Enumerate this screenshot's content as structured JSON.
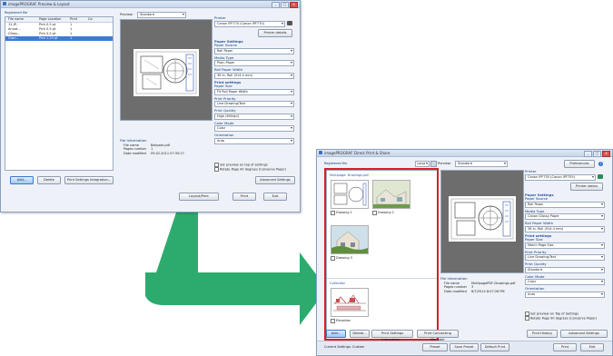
{
  "arrow_color": "#2dab6e",
  "highlight_color": "#d8202a",
  "window1": {
    "title": "imagePROGRAF Preview & Layout",
    "sort_label": "Registered file",
    "columns": [
      "File name",
      "Page Location",
      "Print",
      "Co"
    ],
    "files": [
      {
        "name": "12.JP...",
        "loc": "Pmt 0.5 pt",
        "print": "1"
      },
      {
        "name": "Annot...",
        "loc": "Pmt 0.5 pt",
        "print": "1"
      },
      {
        "name": "Gilroy...",
        "loc": "Pmt 0.5 pt",
        "print": "1"
      },
      {
        "name": "Gran...",
        "loc": "Pmt 1.25 pt",
        "print": "1"
      }
    ],
    "preview_label": "Preview:",
    "preview_value": "Standard",
    "printer_label": "Printer",
    "printer_value": "Canon iPF770 (Canon iPF770)",
    "printer_button": "Printer details",
    "sections": [
      {
        "title": "Paper Settings",
        "fields": [
          "Paper Source",
          "Roll Paper",
          "Media Type",
          "Plain Paper",
          "Roll Paper Width",
          "36 in. Roll (914.4 mm)"
        ]
      },
      {
        "title": "Print settings",
        "fields": [
          "Paper Size",
          "Fit Roll Paper Width",
          "Print Priority",
          "Line Drawing/Text",
          "Print Quality",
          "High (600dpi)",
          "Color Mode",
          "Color",
          "Orientation",
          "Auto"
        ]
      }
    ],
    "file_info_title": "File Information",
    "file_info": [
      {
        "k": "File name",
        "v": "Ballpark.pdf"
      },
      {
        "k": "Pages number",
        "v": "1"
      },
      {
        "k": "Date modified",
        "v": "09.02.2011 07:35:27"
      }
    ],
    "checks": [
      "Set preview on top of settings",
      "Rotate Page 90 degrees (Conserve Paper)"
    ],
    "buttons": {
      "add": "Add...",
      "delete": "Delete",
      "print_settings": "Print Settings Integration...",
      "advanced": "Advanced Settings",
      "layout": "Layout/Print",
      "print": "Print",
      "exit": "Exit"
    }
  },
  "window2": {
    "title": "imagePROGRAF Direct Print & Share",
    "sort_label": "Registered file",
    "sort_value": "Large icons",
    "preview_label": "Preview:",
    "preview_value": "Standard",
    "pref_button": "Preferences",
    "printer_label": "Printer",
    "printer_value": "Canon iPF755 (Canon iPF755)",
    "printer_button": "Printer status",
    "groups": [
      {
        "title": "Multipage: Drawings.pdf",
        "items": [
          {
            "label": "Drawing 1",
            "kind": "plan"
          },
          {
            "label": "Drawing 2",
            "kind": "house"
          },
          {
            "label": "Drawing 3",
            "kind": "house2"
          }
        ]
      },
      {
        "title": "Collection",
        "items": [
          {
            "label": "Elevation",
            "kind": "elevation"
          }
        ]
      }
    ],
    "sections": [
      {
        "title": "Paper Settings",
        "fields": [
          "Paper Source",
          "Roll Paper",
          "Media Type",
          "Canon Glossy Paper",
          "Roll Paper Width",
          "36 in. Roll (914.4 mm)"
        ]
      },
      {
        "title": "Print settings",
        "fields": [
          "Paper Size",
          "Match Page Size",
          "Print Priority",
          "Line Drawing/Text",
          "Print Quality",
          "Standard",
          "Color Mode",
          "Color",
          "Orientation",
          "Auto"
        ]
      }
    ],
    "file_info_title": "File information",
    "file_info": [
      {
        "k": "File name",
        "v": "MultipagePDF-Drawings.pdf"
      },
      {
        "k": "Pages number",
        "v": "3"
      },
      {
        "k": "Date modified",
        "v": "6/7/2014 8:07:28 PM"
      }
    ],
    "checks": [
      "Set preview on Top of Settings",
      "Rotate Page 90 degrees (Conserve Paper)"
    ],
    "buttons": {
      "add": "Add...",
      "delete": "Delete...",
      "print_settings": "Print Settings Integration...",
      "print_connection": "Print Connecting Manager",
      "print_history": "Print History",
      "advanced": "Advanced Settings",
      "print": "Print",
      "exit": "Exit"
    },
    "status": "Current Settings: Custom",
    "status_buttons": [
      "Preset",
      "Save Preset",
      "Default Print"
    ]
  }
}
